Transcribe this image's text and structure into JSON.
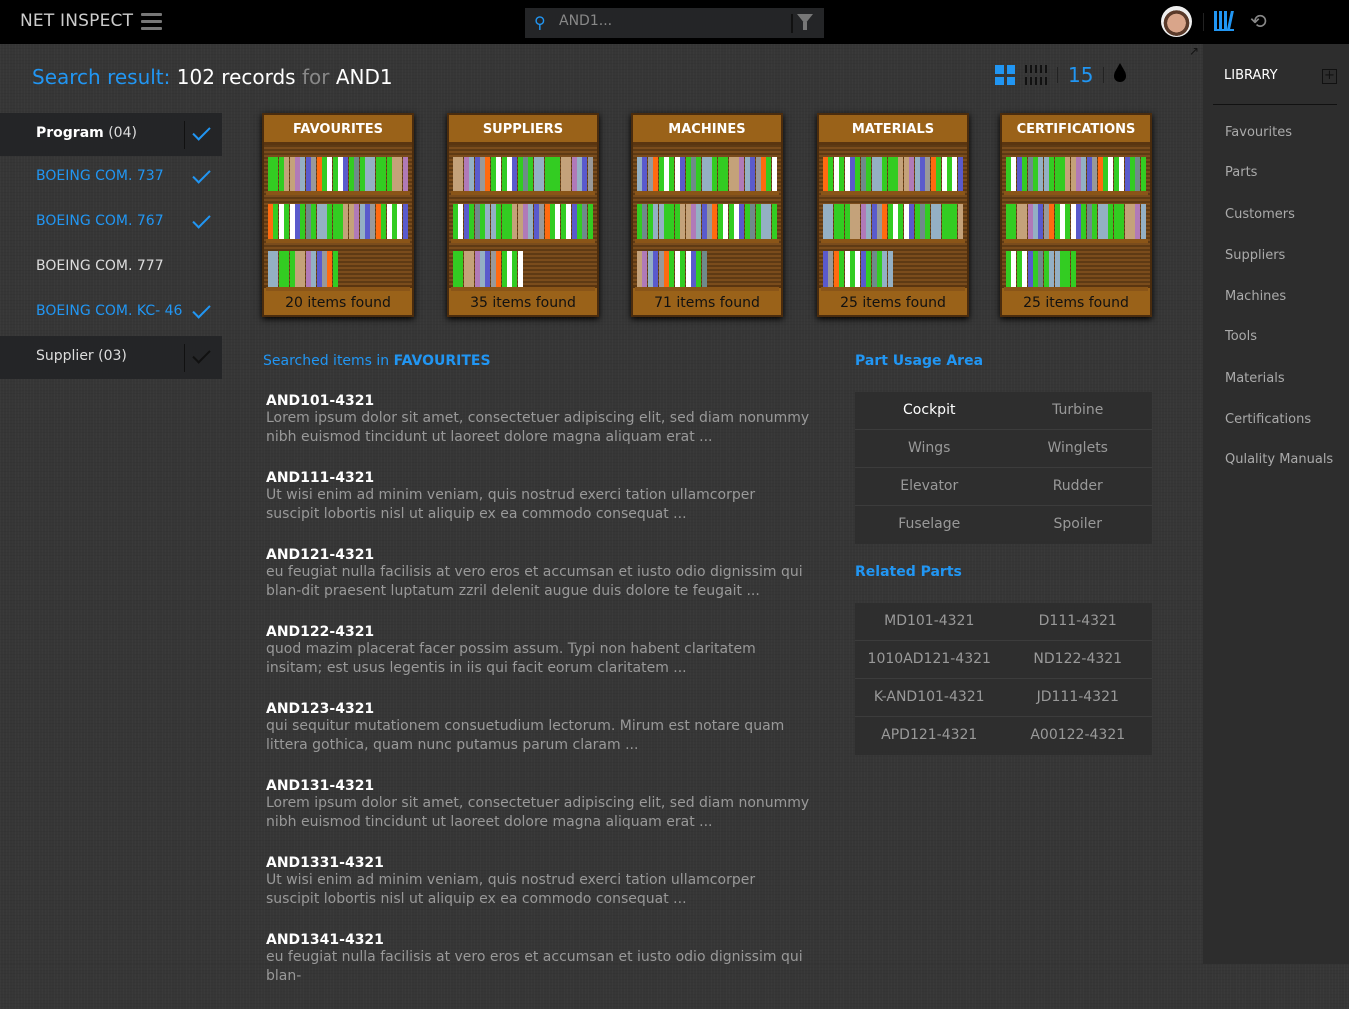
{
  "header": {
    "brand": "NET INSPECT",
    "search_value": "AND1..."
  },
  "title": {
    "prefix": "Search result:",
    "count": "102 records",
    "mid": "for",
    "query": "AND1"
  },
  "toolbar": {
    "page_size": "15"
  },
  "filters": [
    {
      "label": "Program",
      "count": "(04)",
      "type": "header",
      "checked": true
    },
    {
      "label": "BOEING COM. 737",
      "checked": true
    },
    {
      "label": "BOEING COM. 767",
      "checked": true
    },
    {
      "label": "BOEING COM. 777",
      "checked": false
    },
    {
      "label": "BOEING COM. KC- 46",
      "checked": true
    },
    {
      "label": "Supplier",
      "count": "(03)",
      "type": "header",
      "checked": true
    }
  ],
  "shelves": [
    {
      "title": "FAVOURITES",
      "found": "20 items found"
    },
    {
      "title": "SUPPLIERS",
      "found": "35 items found"
    },
    {
      "title": "MACHINES",
      "found": "71 items found"
    },
    {
      "title": "MATERIALS",
      "found": "25 items found"
    },
    {
      "title": "CERTIFICATIONS",
      "found": "25 items found"
    }
  ],
  "searched": {
    "prefix": "Searched items in",
    "category": "FAVOURITES"
  },
  "results": [
    {
      "code": "AND101-4321",
      "desc": "Lorem ipsum dolor sit amet, consectetuer adipiscing elit, sed diam nonummy nibh euismod tincidunt ut laoreet dolore magna aliquam erat ..."
    },
    {
      "code": "AND111-4321",
      "desc": "Ut wisi enim ad minim veniam, quis nostrud exerci tation ullamcorper suscipit lobortis nisl ut aliquip ex ea commodo consequat ..."
    },
    {
      "code": "AND121-4321",
      "desc": "eu feugiat nulla facilisis at vero eros et accumsan et iusto odio dignissim qui blan-dit praesent luptatum zzril delenit augue duis dolore te feugait ..."
    },
    {
      "code": "AND122-4321",
      "desc": "quod mazim placerat facer possim assum. Typi non habent claritatem insitam; est usus legentis in iis qui facit eorum claritatem ..."
    },
    {
      "code": "AND123-4321",
      "desc": "qui sequitur mutationem consuetudium lectorum. Mirum est notare quam littera gothica, quam nunc putamus parum claram ..."
    },
    {
      "code": "AND131-4321",
      "desc": "Lorem ipsum dolor sit amet, consectetuer adipiscing elit, sed diam nonummy nibh euismod tincidunt ut laoreet dolore magna aliquam erat ..."
    },
    {
      "code": "AND1331-4321",
      "desc": "Ut wisi enim ad minim veniam, quis nostrud exerci tation ullamcorper suscipit lobortis nisl ut aliquip ex ea commodo consequat ..."
    },
    {
      "code": "AND1341-4321",
      "desc": "eu feugiat nulla facilisis at vero eros et accumsan et iusto odio dignissim qui blan-"
    }
  ],
  "part_usage": {
    "title": "Part Usage Area",
    "rows": [
      [
        "Cockpit",
        "Turbine"
      ],
      [
        "Wings",
        "Winglets"
      ],
      [
        "Elevator",
        "Rudder"
      ],
      [
        "Fuselage",
        "Spoiler"
      ]
    ]
  },
  "related": {
    "title": "Related Parts",
    "rows": [
      [
        "MD101-4321",
        "D111-4321"
      ],
      [
        "1010AD121-4321",
        "ND122-4321"
      ],
      [
        "K-AND101-4321",
        "JD111-4321"
      ],
      [
        "APD121-4321",
        "A00122-4321"
      ]
    ]
  },
  "library": {
    "title": "LIBRARY",
    "items": [
      "Favourites",
      "Parts",
      "Customers",
      "Suppliers",
      "Machines",
      "Tools",
      "Materials",
      "Certifications",
      "Qulality Manuals"
    ]
  },
  "colors": {
    "accent": "#2196f3",
    "shelf": "#9a6219"
  }
}
